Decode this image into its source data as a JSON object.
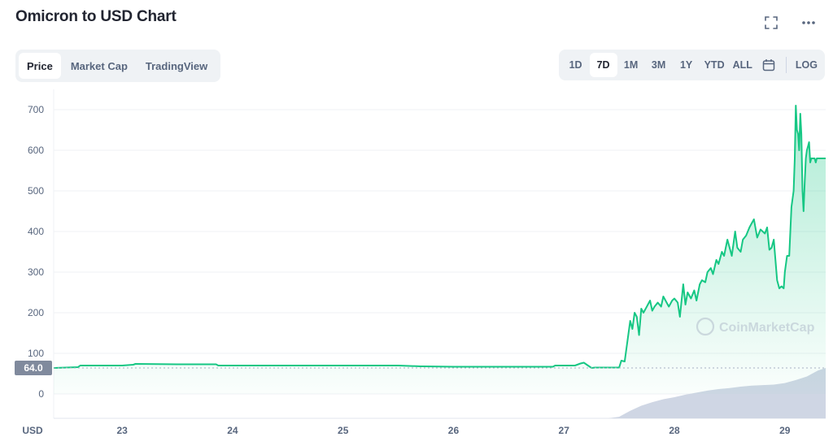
{
  "header": {
    "title": "Omicron to USD Chart"
  },
  "tabs": [
    {
      "label": "Price",
      "active": true
    },
    {
      "label": "Market Cap",
      "active": false
    },
    {
      "label": "TradingView",
      "active": false
    }
  ],
  "ranges": [
    {
      "label": "1D",
      "active": false
    },
    {
      "label": "7D",
      "active": true
    },
    {
      "label": "1M",
      "active": false
    },
    {
      "label": "3M",
      "active": false
    },
    {
      "label": "1Y",
      "active": false
    },
    {
      "label": "YTD",
      "active": false
    },
    {
      "label": "ALL",
      "active": false
    }
  ],
  "log_label": "LOG",
  "watermark": "CoinMarketCap",
  "colors": {
    "line": "#16c784",
    "fill": "#16c784",
    "volume": "#cfd6e4",
    "price_tag_bg": "#808a9d"
  },
  "chart_data": {
    "type": "area",
    "currency_label": "USD",
    "current_price_label": "64.0",
    "y_ticks": [
      0,
      100,
      200,
      300,
      400,
      500,
      600,
      700
    ],
    "ylim": [
      -60,
      750
    ],
    "x_ticks": [
      "23",
      "24",
      "25",
      "26",
      "27",
      "28",
      "29"
    ],
    "x_tick_days": [
      23,
      24,
      25,
      26,
      27,
      28,
      29
    ],
    "xlim": [
      22.38,
      29.37
    ],
    "grid": true,
    "series": [
      {
        "x": [
          22.38,
          22.6,
          22.62,
          23.0,
          23.1,
          23.12,
          23.5,
          23.85,
          23.87,
          24.5,
          25.0,
          25.5,
          25.7,
          25.72,
          26.0,
          26.5,
          26.9,
          26.92,
          27.1,
          27.15,
          27.18,
          27.25,
          27.28,
          27.5,
          27.52,
          27.55,
          27.6,
          27.62,
          27.64,
          27.66,
          27.68,
          27.7,
          27.72,
          27.75,
          27.78,
          27.8,
          27.82,
          27.85,
          27.88,
          27.9,
          27.93,
          27.95,
          27.98,
          28.0,
          28.03,
          28.05,
          28.08,
          28.1,
          28.12,
          28.15,
          28.18,
          28.2,
          28.23,
          28.25,
          28.28,
          28.3,
          28.33,
          28.35,
          28.38,
          28.4,
          28.43,
          28.45,
          28.48,
          28.5,
          28.52,
          28.55,
          28.57,
          28.6,
          28.62,
          28.65,
          28.68,
          28.7,
          28.72,
          28.75,
          28.78,
          28.8,
          28.82,
          28.84,
          28.86,
          28.88,
          28.9,
          28.93,
          28.95,
          28.97,
          28.99,
          29.0,
          29.02,
          29.04,
          29.06,
          29.08,
          29.09,
          29.1,
          29.11,
          29.12,
          29.13,
          29.14,
          29.15,
          29.16,
          29.17,
          29.18,
          29.19,
          29.2,
          29.21,
          29.22,
          29.23,
          29.24,
          29.25,
          29.27,
          29.28,
          29.29,
          29.3,
          29.32,
          29.35,
          29.37
        ],
        "y": [
          64,
          66,
          70,
          70,
          72,
          74,
          73,
          73,
          70,
          70,
          70,
          70,
          68,
          68,
          67,
          67,
          67,
          70,
          70,
          75,
          77,
          64,
          65,
          65,
          82,
          80,
          180,
          160,
          200,
          190,
          145,
          210,
          200,
          215,
          230,
          205,
          215,
          225,
          215,
          240,
          225,
          215,
          230,
          235,
          225,
          190,
          270,
          220,
          250,
          235,
          255,
          230,
          270,
          280,
          275,
          300,
          310,
          295,
          330,
          320,
          350,
          340,
          380,
          360,
          340,
          400,
          360,
          350,
          380,
          390,
          410,
          420,
          430,
          385,
          405,
          400,
          395,
          410,
          355,
          360,
          380,
          280,
          260,
          265,
          260,
          300,
          340,
          340,
          460,
          500,
          580,
          710,
          650,
          640,
          600,
          690,
          640,
          500,
          450,
          520,
          580,
          600,
          610,
          620,
          570,
          580,
          580,
          580,
          570,
          580,
          580,
          580,
          580,
          580
        ]
      }
    ],
    "volume": {
      "x": [
        22.38,
        27.4,
        27.5,
        27.6,
        27.7,
        27.8,
        27.9,
        28.0,
        28.1,
        28.2,
        28.3,
        28.4,
        28.5,
        28.6,
        28.7,
        28.8,
        28.9,
        29.0,
        29.1,
        29.2,
        29.3,
        29.37
      ],
      "y": [
        0,
        0,
        0.03,
        0.15,
        0.25,
        0.32,
        0.38,
        0.42,
        0.47,
        0.51,
        0.55,
        0.58,
        0.6,
        0.63,
        0.65,
        0.66,
        0.67,
        0.7,
        0.76,
        0.83,
        0.95,
        1.0
      ]
    }
  }
}
